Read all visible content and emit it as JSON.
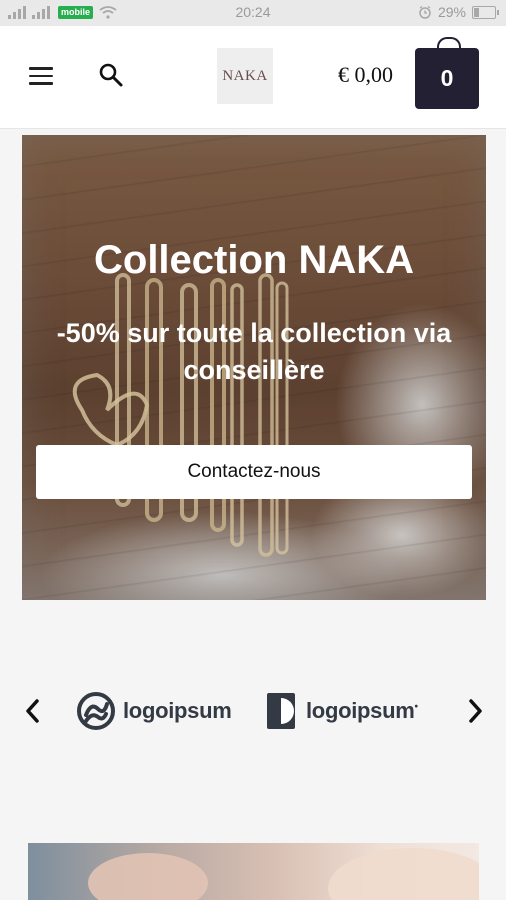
{
  "status_bar": {
    "carrier_badge": "mobile",
    "time": "20:24",
    "battery": "29%",
    "icons": [
      "signal-icon",
      "signal-icon",
      "wifi-icon",
      "alarm-icon",
      "battery-icon"
    ]
  },
  "header": {
    "logo_text": "NAKA",
    "cart_total": "€ 0,00",
    "cart_count": "0",
    "icons": [
      "menu-icon",
      "search-icon",
      "cart-icon"
    ]
  },
  "hero": {
    "title": "Collection NAKA",
    "subtitle": "-50% sur toute la collection via conseillère",
    "button_label": "Contactez-nous"
  },
  "logos": {
    "items": [
      {
        "name": "logoipsum",
        "icon": "logoipsum-circle-icon"
      },
      {
        "name": "logoipsum",
        "icon": "logoipsum-halfcircle-icon",
        "mark": "•"
      }
    ],
    "icons": [
      "chevron-left-icon",
      "chevron-right-icon"
    ]
  },
  "colors": {
    "cart_button": "#232033",
    "brand_text": "#333a44",
    "badge_green": "#27ae4f"
  }
}
